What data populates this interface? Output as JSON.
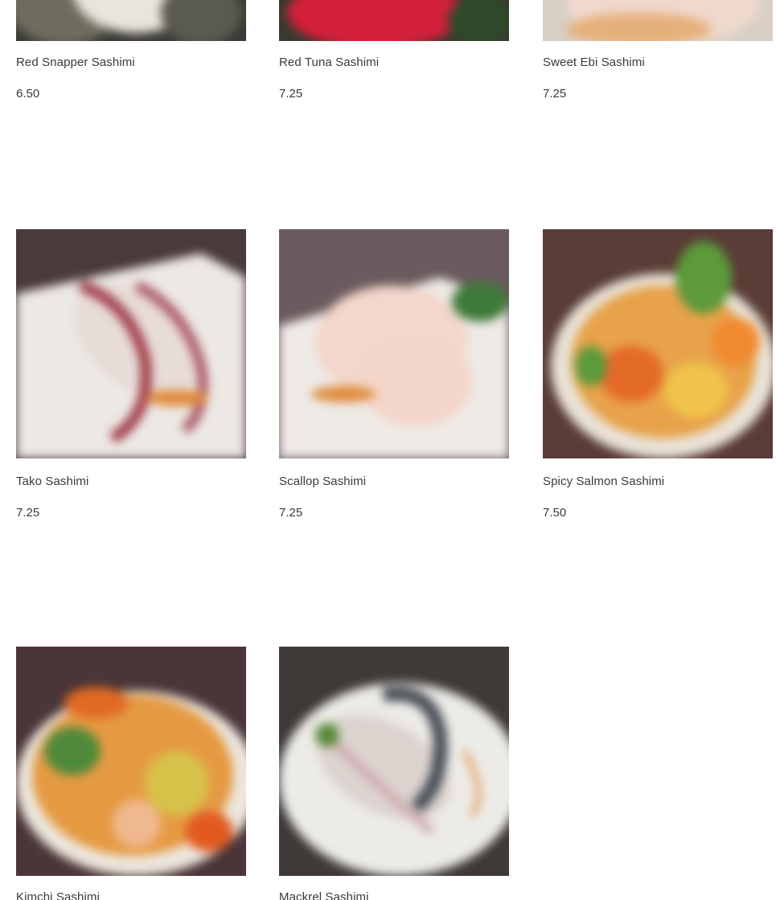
{
  "menu": {
    "items": [
      {
        "name": "Red Snapper Sashimi",
        "price": "6.50"
      },
      {
        "name": "Red Tuna Sashimi",
        "price": "7.25"
      },
      {
        "name": "Sweet Ebi Sashimi",
        "price": "7.25"
      },
      {
        "name": "Tako Sashimi",
        "price": "7.25"
      },
      {
        "name": "Scallop Sashimi",
        "price": "7.25"
      },
      {
        "name": "Spicy Salmon Sashimi",
        "price": "7.50"
      },
      {
        "name": "Kimchi Sashimi",
        "price": ""
      },
      {
        "name": "Mackrel Sashimi",
        "price": ""
      }
    ]
  }
}
